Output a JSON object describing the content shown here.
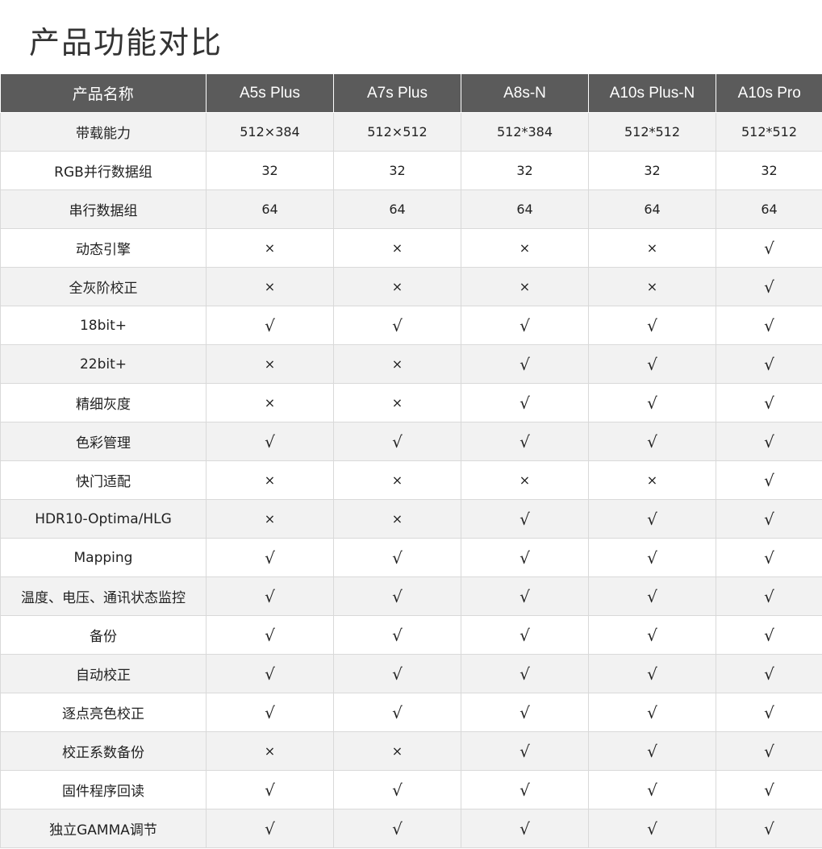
{
  "title": "产品功能对比",
  "header": [
    "产品名称",
    "A5s Plus",
    "A7s Plus",
    "A8s-N",
    "A10s Plus-N",
    "A10s Pro"
  ],
  "rows": [
    {
      "feature": "带载能力",
      "values": [
        "512×384",
        "512×512",
        "512*384",
        "512*512",
        "512*512"
      ]
    },
    {
      "feature": "RGB并行数据组",
      "values": [
        "32",
        "32",
        "32",
        "32",
        "32"
      ]
    },
    {
      "feature": "串行数据组",
      "values": [
        "64",
        "64",
        "64",
        "64",
        "64"
      ]
    },
    {
      "feature": "动态引擎",
      "values": [
        "×",
        "×",
        "×",
        "×",
        "√"
      ]
    },
    {
      "feature": "全灰阶校正",
      "values": [
        "×",
        "×",
        "×",
        "×",
        "√"
      ]
    },
    {
      "feature": "18bit+",
      "values": [
        "√",
        "√",
        "√",
        "√",
        "√"
      ]
    },
    {
      "feature": "22bit+",
      "values": [
        "×",
        "×",
        "√",
        "√",
        "√"
      ]
    },
    {
      "feature": "精细灰度",
      "values": [
        "×",
        "×",
        "√",
        "√",
        "√"
      ]
    },
    {
      "feature": "色彩管理",
      "values": [
        "√",
        "√",
        "√",
        "√",
        "√"
      ]
    },
    {
      "feature": "快门适配",
      "values": [
        "×",
        "×",
        "×",
        "×",
        "√"
      ]
    },
    {
      "feature": "HDR10-Optima/HLG",
      "values": [
        "×",
        "×",
        "√",
        "√",
        "√"
      ]
    },
    {
      "feature": "Mapping",
      "values": [
        "√",
        "√",
        "√",
        "√",
        "√"
      ]
    },
    {
      "feature": "温度、电压、通讯状态监控",
      "values": [
        "√",
        "√",
        "√",
        "√",
        "√"
      ]
    },
    {
      "feature": "备份",
      "values": [
        "√",
        "√",
        "√",
        "√",
        "√"
      ]
    },
    {
      "feature": "自动校正",
      "values": [
        "√",
        "√",
        "√",
        "√",
        "√"
      ]
    },
    {
      "feature": "逐点亮色校正",
      "values": [
        "√",
        "√",
        "√",
        "√",
        "√"
      ]
    },
    {
      "feature": "校正系数备份",
      "values": [
        "×",
        "×",
        "√",
        "√",
        "√"
      ]
    },
    {
      "feature": "固件程序回读",
      "values": [
        "√",
        "√",
        "√",
        "√",
        "√"
      ]
    },
    {
      "feature": "独立GAMMA调节",
      "values": [
        "√",
        "√",
        "√",
        "√",
        "√"
      ]
    }
  ]
}
